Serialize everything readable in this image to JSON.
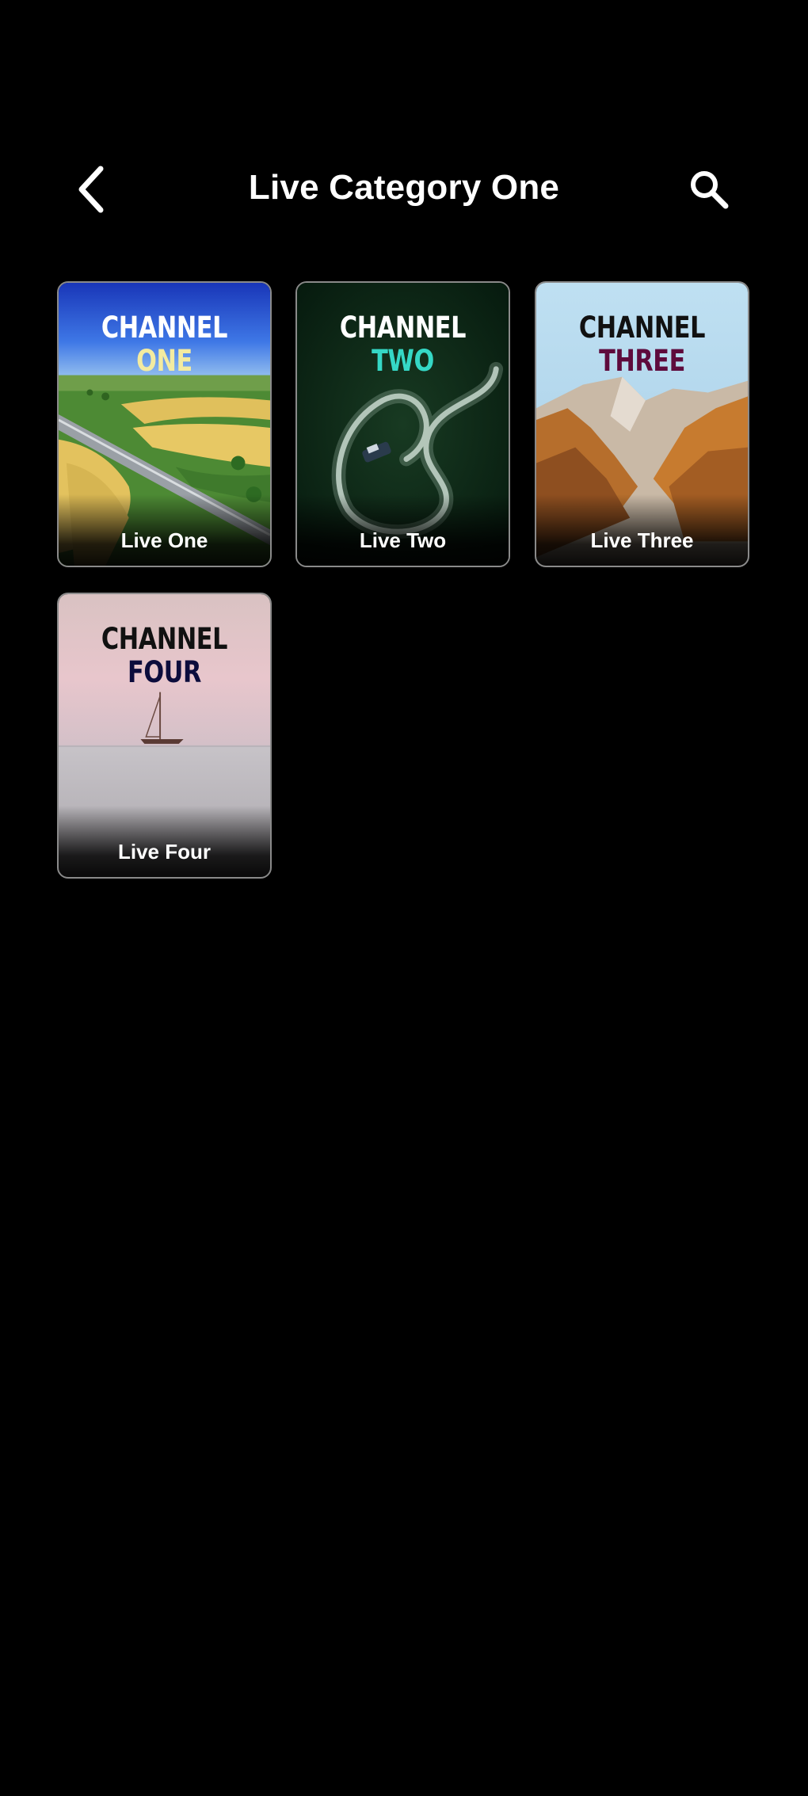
{
  "header": {
    "title": "Live Category One",
    "back_icon": "chevron-left-icon",
    "search_icon": "search-icon"
  },
  "channels": [
    {
      "brand_line1": "CHANNEL",
      "brand_line2": "ONE",
      "line2_color": "#f3eba0",
      "line1_color": "#ffffff",
      "label": "Live One"
    },
    {
      "brand_line1": "CHANNEL",
      "brand_line2": "TWO",
      "line2_color": "#35d8c6",
      "line1_color": "#ffffff",
      "label": "Live Two"
    },
    {
      "brand_line1": "CHANNEL",
      "brand_line2": "THREE",
      "line2_color": "#5e0a3c",
      "line1_color": "#111111",
      "label": "Live Three"
    },
    {
      "brand_line1": "CHANNEL",
      "brand_line2": "FOUR",
      "line2_color": "#0c0c3c",
      "line1_color": "#111111",
      "label": "Live Four"
    }
  ]
}
